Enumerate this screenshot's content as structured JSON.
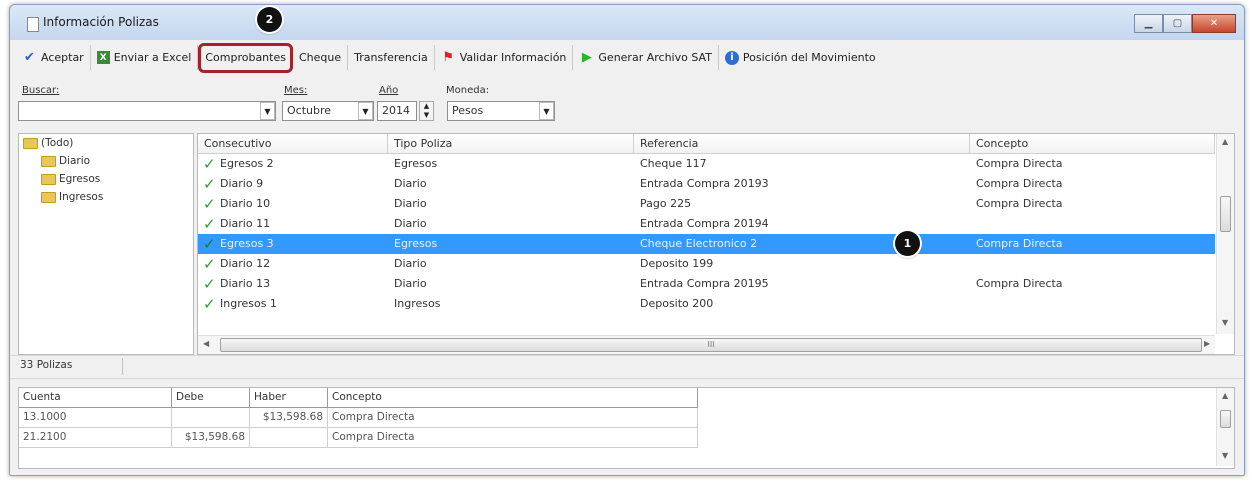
{
  "window": {
    "title": "Información Polizas"
  },
  "toolbar": {
    "items": [
      {
        "label": "Aceptar",
        "icon": "checkmark-icon"
      },
      {
        "label": "Enviar a Excel",
        "icon": "excel-icon"
      },
      {
        "label": "Comprobantes",
        "highlighted": true
      },
      {
        "label": "Cheque"
      },
      {
        "label": "Transferencia"
      },
      {
        "label": "Validar Información",
        "icon": "flag-icon"
      },
      {
        "label": "Generar Archivo SAT",
        "icon": "play-icon"
      },
      {
        "label": "Posición del Movimiento",
        "icon": "info-icon"
      }
    ]
  },
  "filters": {
    "buscar_label": "Buscar:",
    "buscar_value": "",
    "mes_label": "Mes:",
    "mes_value": "Octubre",
    "anio_label": "Año",
    "anio_value": "2014",
    "moneda_label": "Moneda:",
    "moneda_value": "Pesos"
  },
  "tree": {
    "root": "(Todo)",
    "children": [
      "Diario",
      "Egresos",
      "Ingresos"
    ]
  },
  "grid": {
    "columns": [
      "Consecutivo",
      "Tipo Poliza",
      "Referencia",
      "Concepto"
    ],
    "rows": [
      {
        "consecutivo": "Egresos 2",
        "tipo": "Egresos",
        "referencia": "Cheque 117",
        "concepto": "Compra Directa"
      },
      {
        "consecutivo": "Diario 9",
        "tipo": "Diario",
        "referencia": "Entrada Compra 20193",
        "concepto": "Compra Directa"
      },
      {
        "consecutivo": "Diario 10",
        "tipo": "Diario",
        "referencia": "Pago 225",
        "concepto": "Compra Directa"
      },
      {
        "consecutivo": "Diario 11",
        "tipo": "Diario",
        "referencia": "Entrada Compra 20194",
        "concepto": ""
      },
      {
        "consecutivo": "Egresos 3",
        "tipo": "Egresos",
        "referencia": "Cheque Electronico 2",
        "concepto": "Compra Directa",
        "selected": true
      },
      {
        "consecutivo": "Diario 12",
        "tipo": "Diario",
        "referencia": "Deposito 199",
        "concepto": ""
      },
      {
        "consecutivo": "Diario 13",
        "tipo": "Diario",
        "referencia": "Entrada Compra 20195",
        "concepto": "Compra Directa"
      },
      {
        "consecutivo": "Ingresos 1",
        "tipo": "Ingresos",
        "referencia": "Deposito 200",
        "concepto": ""
      }
    ],
    "hscroll_grip": "III"
  },
  "status": {
    "count": "33 Polizas"
  },
  "detail": {
    "columns": [
      "Cuenta",
      "Debe",
      "Haber",
      "Concepto"
    ],
    "rows": [
      {
        "cuenta": "13.1000",
        "debe": "",
        "haber": "$13,598.68",
        "concepto": "Compra Directa"
      },
      {
        "cuenta": "21.2100",
        "debe": "$13,598.68",
        "haber": "",
        "concepto": "Compra Directa"
      }
    ]
  },
  "callouts": {
    "one": "1",
    "two": "2"
  },
  "colors": {
    "selection": "#3399ff",
    "highlight_border": "#a3232b",
    "check": "#2f9e2f"
  }
}
